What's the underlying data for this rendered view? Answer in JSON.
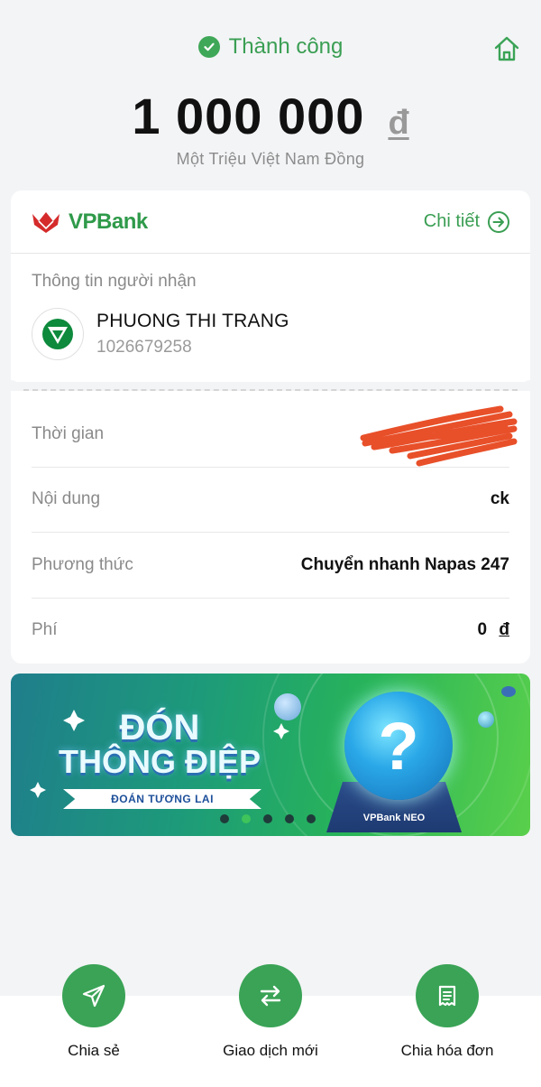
{
  "header": {
    "status_text": "Thành công",
    "amount": "1 000 000",
    "currency": "đ",
    "amount_words": "Một Triệu Việt Nam Đồng"
  },
  "card": {
    "bank_name": "VPBank",
    "detail_link": "Chi tiết",
    "recipient_label": "Thông tin người nhận",
    "recipient_name": "PHUONG THI TRANG",
    "recipient_account": "1026679258",
    "rows": [
      {
        "label": "Thời gian",
        "value": ""
      },
      {
        "label": "Nội dung",
        "value": "ck"
      },
      {
        "label": "Phương thức",
        "value": "Chuyển nhanh Napas 247"
      },
      {
        "label": "Phí",
        "value": "0",
        "currency": "đ"
      }
    ]
  },
  "banner": {
    "title_line1": "ĐÓN",
    "title_line2": "THÔNG ĐIỆP",
    "ribbon": "ĐOÁN TƯƠNG LAI",
    "brand": "VPBank NEO",
    "orb_symbol": "?",
    "dots": 5,
    "active_dot": 1
  },
  "actions": [
    {
      "label": "Chia sẻ",
      "icon": "send-icon"
    },
    {
      "label": "Giao dịch mới",
      "icon": "swap-icon"
    },
    {
      "label": "Chia hóa đơn",
      "icon": "bill-icon"
    }
  ],
  "colors": {
    "primary": "#3aa356",
    "background": "#f3f4f6",
    "redaction": "#e8502a"
  }
}
